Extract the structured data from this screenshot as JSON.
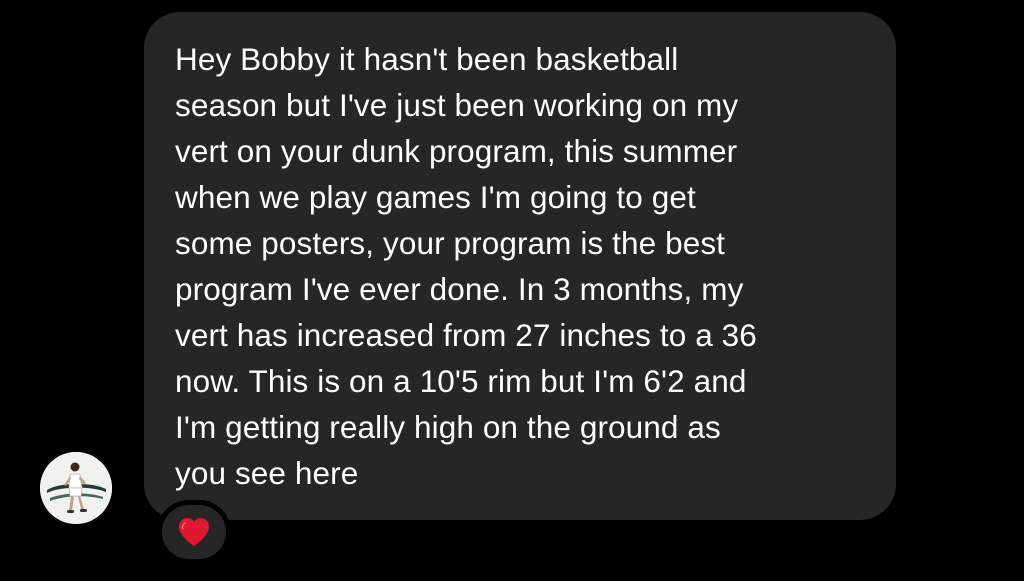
{
  "message": {
    "text": "Hey Bobby it hasn't been basketball\nseason but I've just been working on my\nvert on your dunk program, this summer\nwhen we play games I'm going to get\nsome posters, your program is the best\nprogram I've ever done. In 3 months, my\nvert has increased from 27 inches to a 36\nnow. This is on a 10'5 rim but I'm 6'2 and\nI'm getting really high on the ground as\nyou see here",
    "bubble_color": "#262626",
    "text_color": "#ffffff"
  },
  "sender": {
    "avatar_icon": "basketball-player-avatar"
  },
  "reaction": {
    "icon": "red-heart-icon",
    "color": "#e0182f"
  },
  "theme": {
    "background": "#000000"
  }
}
